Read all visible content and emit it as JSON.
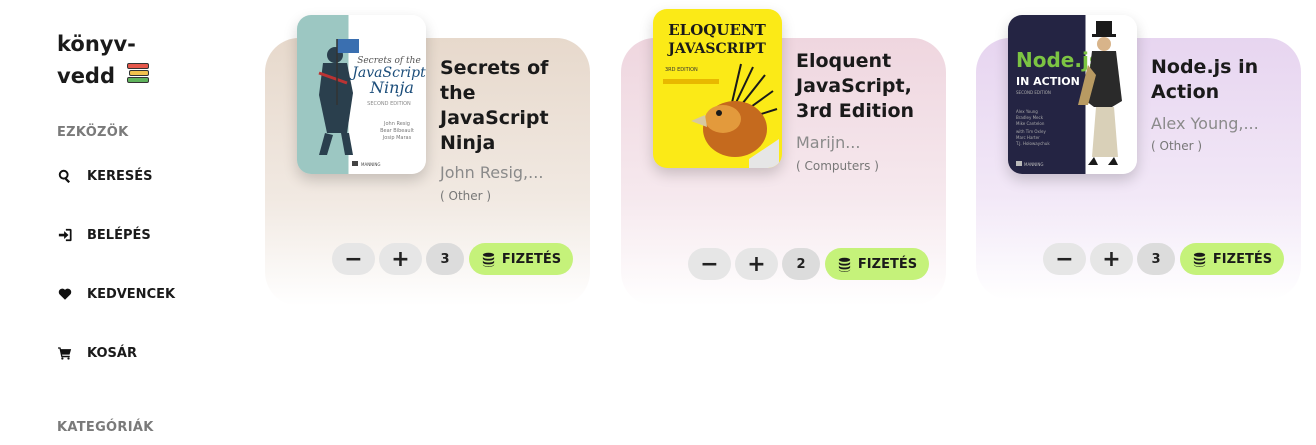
{
  "sidebar": {
    "logo_line1": "könyv-",
    "logo_line2": "vedd",
    "logo_icon": "books-icon",
    "tools_title": "EZKÖZÖK",
    "items": [
      {
        "label": "KERESÉS",
        "icon": "search-icon"
      },
      {
        "label": "BELÉPÉS",
        "icon": "login-icon"
      },
      {
        "label": "KEDVENCEK",
        "icon": "heart-icon"
      },
      {
        "label": "KOSÁR",
        "icon": "cart-icon"
      }
    ],
    "categories_title": "KATEGÓRIÁK"
  },
  "colors": {
    "pay_button": "#c5f27a",
    "card1_top": "#e7d9cc",
    "card2_top": "#efd6df",
    "card3_top": "#e7d5f0"
  },
  "cards": [
    {
      "title": "Secrets of the JavaScript Ninja",
      "author": "John Resig,...",
      "category": "( Other )",
      "quantity": "3",
      "minus": "−",
      "plus": "+",
      "pay_label": "FIZETÉS",
      "cover_title": "Secrets of the JavaScript Ninja"
    },
    {
      "title": "Eloquent JavaScript, 3rd Edition",
      "author": "Marijn...",
      "category": "( Computers )",
      "quantity": "2",
      "minus": "−",
      "plus": "+",
      "pay_label": "FIZETÉS",
      "cover_title_1": "ELOQUENT",
      "cover_title_2": "JAVASCRIPT",
      "cover_edition": "3RD EDITION"
    },
    {
      "title": "Node.js in Action",
      "author": "Alex Young,...",
      "category": "( Other )",
      "quantity": "3",
      "minus": "−",
      "plus": "+",
      "pay_label": "FIZETÉS",
      "cover_title_1": "Node.js",
      "cover_title_2": "IN ACTION"
    }
  ]
}
